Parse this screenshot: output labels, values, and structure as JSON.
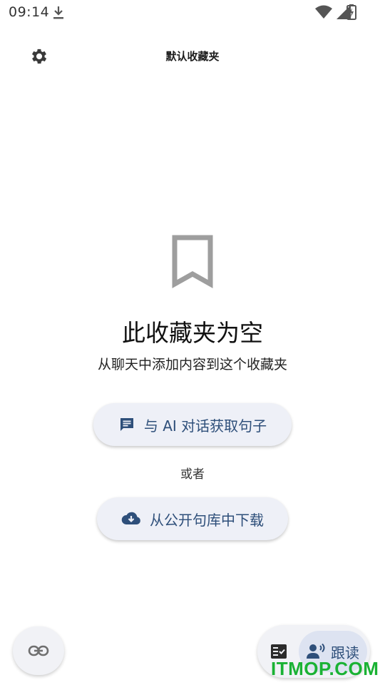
{
  "status_bar": {
    "time": "09:14"
  },
  "app_bar": {
    "title": "默认收藏夹"
  },
  "empty_state": {
    "title": "此收藏夹为空",
    "subtitle": "从聊天中添加内容到这个收藏夹"
  },
  "actions": {
    "chat_label": "与 AI 对话获取句子",
    "or_label": "或者",
    "download_label": "从公开句库中下载"
  },
  "bottom": {
    "read_label": "跟读"
  },
  "watermark": {
    "text": "ITMOP.COM"
  },
  "colors": {
    "accent": "#2e4f7a",
    "pill_bg": "#eef0f7",
    "icon_grey": "#9e9e9e",
    "watermark": "#1ab234"
  }
}
